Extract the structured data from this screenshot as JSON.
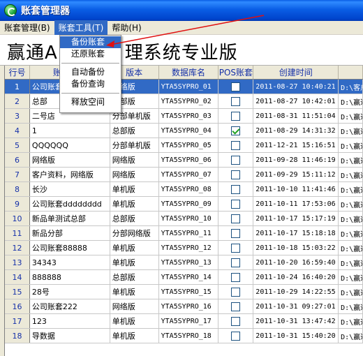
{
  "window": {
    "title": "账套管理器",
    "icon": "app-logo-icon"
  },
  "menu": [
    {
      "label": "账套管理(B)"
    },
    {
      "label": "账套工具(T)"
    },
    {
      "label": "帮助(H)"
    }
  ],
  "banner": {
    "title_part1": "赢通A",
    "title_part2": "理系统专业版"
  },
  "dropdown": {
    "items": [
      "备份账套",
      "还原账套",
      "自动备份",
      "备份查询",
      "释放空间"
    ],
    "highlighted": "备份账套"
  },
  "grid": {
    "headers": [
      "行号",
      "账套名称",
      "版本",
      "数据库名",
      "POS账套",
      "创建时间",
      ""
    ],
    "rows": [
      {
        "no": "1",
        "name": "公司账套",
        "version": "网络版",
        "db": "YTA5SYPRO_01",
        "pos": false,
        "created": "2011-08-27 10:40:21",
        "path": "D:\\客户资料"
      },
      {
        "no": "2",
        "name": "总部",
        "version": "总部版",
        "db": "YTA5SYPRO_02",
        "pos": false,
        "created": "2011-08-27 10:42:01",
        "path": "D:\\赢通"
      },
      {
        "no": "3",
        "name": "二号店",
        "version": "分部单机版",
        "db": "YTA5SYPRO_03",
        "pos": false,
        "created": "2011-08-31 11:51:04",
        "path": "D:\\赢通"
      },
      {
        "no": "4",
        "name": "1",
        "version": "总部版",
        "db": "YTA5SYPRO_04",
        "pos": true,
        "created": "2011-08-29 14:31:32",
        "path": "D:\\赢通"
      },
      {
        "no": "5",
        "name": "QQQQQQ",
        "version": "分部单机版",
        "db": "YTA5SYPRO_05",
        "pos": false,
        "created": "2011-12-21 15:16:51",
        "path": "D:\\赢通"
      },
      {
        "no": "6",
        "name": "网络版",
        "version": "网络版",
        "db": "YTA5SYPRO_06",
        "pos": false,
        "created": "2011-09-28 11:46:19",
        "path": "D:\\赢通"
      },
      {
        "no": "7",
        "name": "客户资料，网络版",
        "version": "网络版",
        "db": "YTA5SYPRO_07",
        "pos": false,
        "created": "2011-09-29 15:11:12",
        "path": "D:\\赢通"
      },
      {
        "no": "8",
        "name": "长沙",
        "version": "单机版",
        "db": "YTA5SYPRO_08",
        "pos": false,
        "created": "2011-10-10 11:41:46",
        "path": "D:\\赢通"
      },
      {
        "no": "9",
        "name": "公司账套dddddddd",
        "version": "单机版",
        "db": "YTA5SYPRO_09",
        "pos": false,
        "created": "2011-10-11 17:53:06",
        "path": "D:\\赢通"
      },
      {
        "no": "10",
        "name": "新品单测试总部",
        "version": "总部版",
        "db": "YTA5SYPRO_10",
        "pos": false,
        "created": "2011-10-17 15:17:19",
        "path": "D:\\赢通"
      },
      {
        "no": "11",
        "name": "新品分部",
        "version": "分部网络版",
        "db": "YTA5SYPRO_11",
        "pos": false,
        "created": "2011-10-17 15:18:18",
        "path": "D:\\赢通"
      },
      {
        "no": "12",
        "name": "公司账套88888",
        "version": "单机版",
        "db": "YTA5SYPRO_12",
        "pos": false,
        "created": "2011-10-18 15:03:22",
        "path": "D:\\赢通"
      },
      {
        "no": "13",
        "name": "34343",
        "version": "单机版",
        "db": "YTA5SYPRO_13",
        "pos": false,
        "created": "2011-10-20 16:59:40",
        "path": "D:\\赢通"
      },
      {
        "no": "14",
        "name": "888888",
        "version": "总部版",
        "db": "YTA5SYPRO_14",
        "pos": false,
        "created": "2011-10-24 16:40:20",
        "path": "D:\\赢通"
      },
      {
        "no": "15",
        "name": "28号",
        "version": "单机版",
        "db": "YTA5SYPRO_15",
        "pos": false,
        "created": "2011-10-29 14:22:55",
        "path": "D:\\赢通"
      },
      {
        "no": "16",
        "name": "公司账套222",
        "version": "网络版",
        "db": "YTA5SYPRO_16",
        "pos": false,
        "created": "2011-10-31 09:27:01",
        "path": "D:\\赢通"
      },
      {
        "no": "17",
        "name": "123",
        "version": "单机版",
        "db": "YTA5SYPRO_17",
        "pos": false,
        "created": "2011-10-31 13:47:42",
        "path": "D:\\赢通"
      },
      {
        "no": "18",
        "name": "导数据",
        "version": "单机版",
        "db": "YTA5SYPRO_18",
        "pos": false,
        "created": "2011-10-31 15:40:20",
        "path": "D:\\赢通"
      }
    ],
    "selected_row": "1"
  },
  "colors": {
    "titlebar": "#0a5ee5",
    "selection": "#316ac5",
    "header_text": "#1530a8",
    "annotation_arrow": "#e01010"
  }
}
